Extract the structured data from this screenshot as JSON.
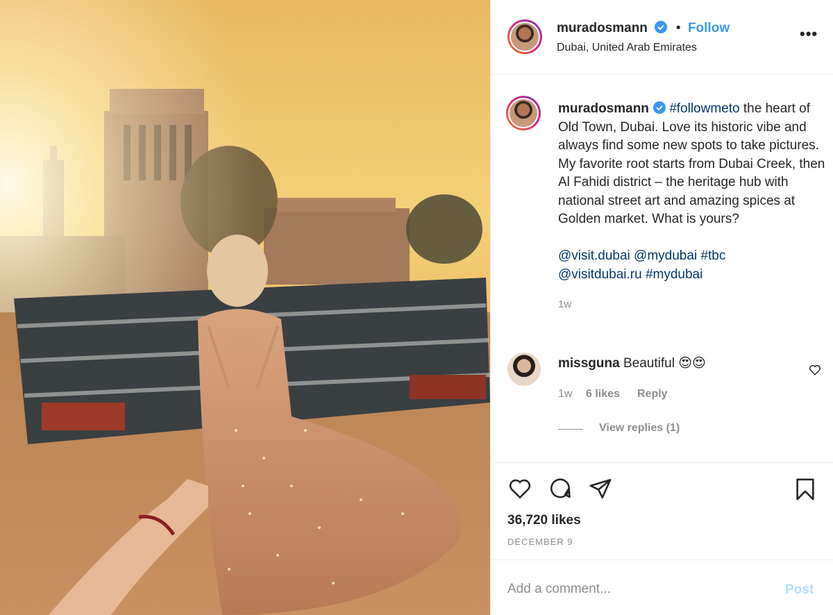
{
  "post": {
    "username": "muradosmann",
    "follow_dot": "•",
    "follow_label": "Follow",
    "location": "Dubai, United Arab Emirates",
    "more_label": "•••"
  },
  "caption": {
    "username": "muradosmann",
    "hashtag": "#followmeto",
    "text": "the heart of Old Town, Dubai. Love its historic vibe and always find some new spots to take pictures. My favorite root starts from Dubai Creek, then Al Fahidi district – the heritage hub with national street art and amazing spices at Golden market. What is yours?",
    "tags_line1": "@visit.dubai @mydubai #tbc",
    "tags_line2": "@visitdubai.ru #mydubai",
    "time": "1w"
  },
  "comment": {
    "username": "missguna",
    "text": "Beautiful 😍😍",
    "time": "1w",
    "likes": "6 likes",
    "reply_label": "Reply",
    "view_replies": "View replies (1)"
  },
  "actions": {
    "likes": "36,720 likes",
    "date": "DECEMBER 9"
  },
  "add_comment": {
    "placeholder": "Add a comment...",
    "post_label": "Post"
  },
  "icons": {
    "verified": "verified-badge-icon",
    "like": "heart-icon",
    "comment": "speech-bubble-icon",
    "share": "paper-plane-icon",
    "save": "bookmark-icon"
  },
  "colors": {
    "link": "#3897f0",
    "hashtag": "#00376b",
    "muted": "#8e8e8e",
    "post_disabled": "#b2dffc"
  }
}
